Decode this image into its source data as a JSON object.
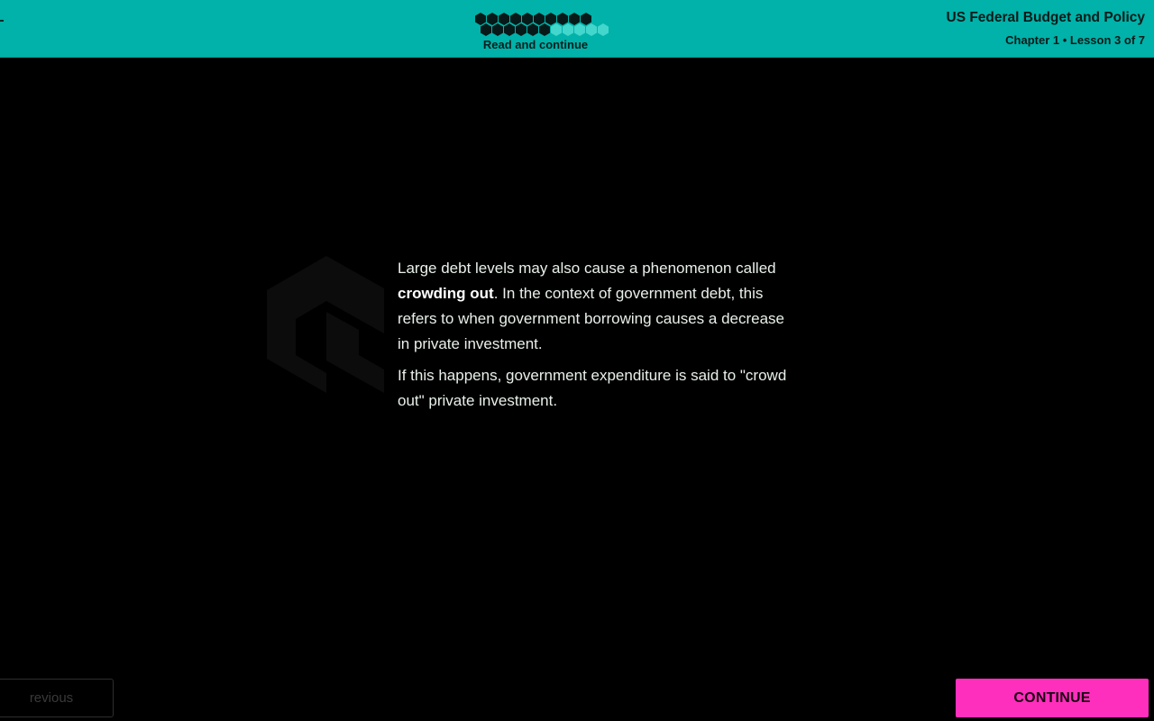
{
  "header": {
    "progress_label": "Read and continue",
    "progress": {
      "completed": 16,
      "total": 21
    },
    "course_title": "US Federal Budget and Policy",
    "lesson_info": "Chapter 1 • Lesson 3 of 7"
  },
  "content": {
    "p1_before": "Large debt levels may also cause a phenomenon called ",
    "p1_bold": "crowding out",
    "p1_after": ". In the context of government debt, this refers to when government borrowing causes a decrease in private investment.",
    "p2": "If this happens, government expenditure is said to \"crowd out\" private investment."
  },
  "footer": {
    "previous_label": "revious",
    "continue_label": "CONTINUE"
  },
  "colors": {
    "header_bg": "#00b2a9",
    "accent_button": "#ff2fbd",
    "page_bg": "#000000"
  },
  "icons": {
    "watermark": "brand-logo-icon"
  }
}
